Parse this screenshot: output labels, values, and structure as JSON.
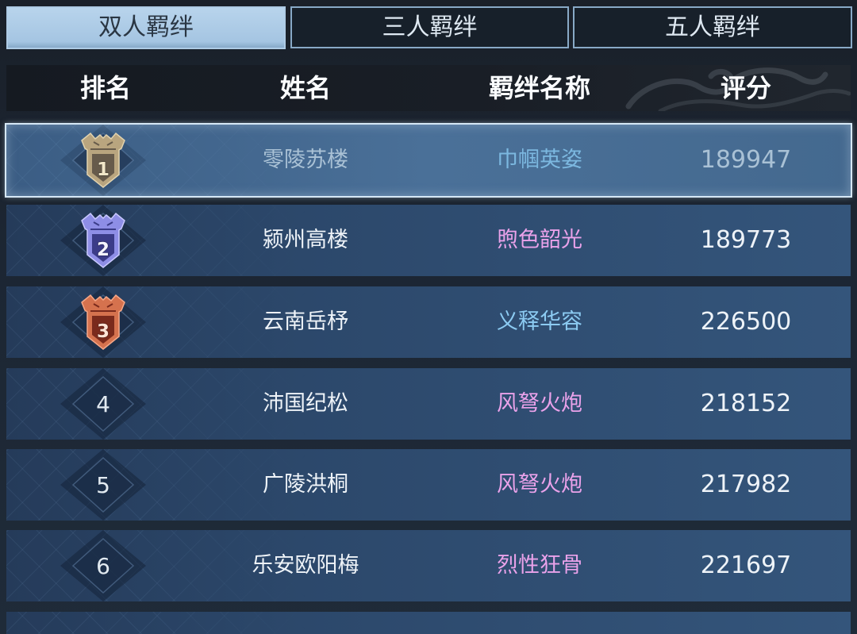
{
  "tabs": [
    {
      "label": "双人羁绊",
      "active": true
    },
    {
      "label": "三人羁绊",
      "active": false
    },
    {
      "label": "五人羁绊",
      "active": false
    }
  ],
  "table": {
    "headers": {
      "rank": "排名",
      "name": "姓名",
      "bond": "羁绊名称",
      "score": "评分"
    },
    "rows": [
      {
        "rank": "1",
        "name": "零陵苏楼",
        "bond": "巾帼英姿",
        "score": "189947",
        "selected": true,
        "text_color": "#a9c1d5",
        "bond_color": "#7cb8e0",
        "badge": {
          "icon": "rank-badge-gold-icon",
          "frame_color": "#b9a57f",
          "rim_color": "#e2d3ae",
          "inner_color": "#675b4b",
          "number_color": "#f1e6c8"
        }
      },
      {
        "rank": "2",
        "name": "颍州高楼",
        "bond": "煦色韶光",
        "score": "189773",
        "selected": false,
        "text_color": "#eef3f8",
        "bond_color": "#eaa2ea",
        "badge": {
          "icon": "rank-badge-violet-icon",
          "frame_color": "#8e8ee6",
          "rim_color": "#c9c9ff",
          "inner_color": "#3b3c88",
          "number_color": "#f4f4ff"
        }
      },
      {
        "rank": "3",
        "name": "云南岳杼",
        "bond": "义释华容",
        "score": "226500",
        "selected": false,
        "text_color": "#eef3f8",
        "bond_color": "#8ccbf2",
        "badge": {
          "icon": "rank-badge-red-icon",
          "frame_color": "#d5724e",
          "rim_color": "#f6a888",
          "inner_color": "#7a2a1c",
          "number_color": "#ffe4d6"
        }
      },
      {
        "rank": "4",
        "name": "沛国纪松",
        "bond": "风弩火炮",
        "score": "218152",
        "selected": false,
        "text_color": "#eef3f8",
        "bond_color": "#eaa2ea"
      },
      {
        "rank": "5",
        "name": "广陵洪桐",
        "bond": "风弩火炮",
        "score": "217982",
        "selected": false,
        "text_color": "#eef3f8",
        "bond_color": "#eaa2ea"
      },
      {
        "rank": "6",
        "name": "乐安欧阳梅",
        "bond": "烈性狂骨",
        "score": "221697",
        "selected": false,
        "text_color": "#eef3f8",
        "bond_color": "#eaa2ea"
      }
    ]
  }
}
